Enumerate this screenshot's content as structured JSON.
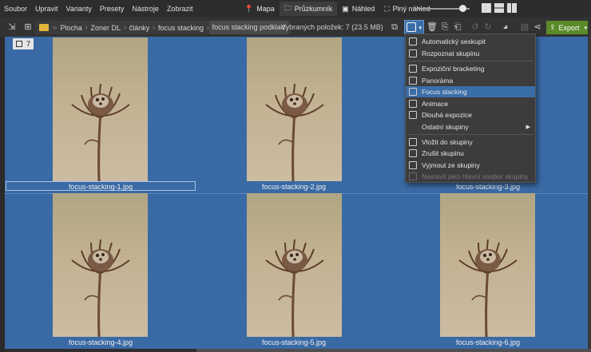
{
  "menubar": {
    "items": [
      "Soubor",
      "Upravit",
      "Varianty",
      "Presety",
      "Nástroje",
      "Zobrazit"
    ],
    "modes": [
      {
        "label": "Mapa",
        "icon": "pin-icon"
      },
      {
        "label": "Průzkumník",
        "icon": "folder-open-icon"
      },
      {
        "label": "Náhled",
        "icon": "image-icon"
      },
      {
        "label": "Plný náhled",
        "icon": "fullscreen-icon"
      }
    ],
    "active_mode": "Průzkumník"
  },
  "toolbar": {
    "breadcrumb": [
      "Plocha",
      "Zoner DL",
      "články",
      "focus stacking",
      "focus stacking podklad"
    ],
    "selection_info": "Vybraných položek: 7 (23.5 MB)",
    "export_label": "Export"
  },
  "content": {
    "count_badge": "7",
    "files": [
      "focus-stacking-1.jpg",
      "focus-stacking-2.jpg",
      "focus-stacking-3.jpg",
      "focus-stacking-4.jpg",
      "focus-stacking-5.jpg",
      "focus-stacking-6.jpg"
    ],
    "selected_file": "focus-stacking-1.jpg"
  },
  "dropdown": {
    "items": [
      {
        "label": "Automatický seskupit",
        "icon": "auto-group-icon",
        "enabled": true
      },
      {
        "label": "Rozpoznat skupinu",
        "icon": "detect-group-icon",
        "enabled": true
      },
      {
        "label": "Expoziční bracketing",
        "icon": "exposure-bracketing-icon",
        "enabled": true
      },
      {
        "label": "Panoráma",
        "icon": "panorama-icon",
        "enabled": true
      },
      {
        "label": "Focus stacking",
        "icon": "focus-stacking-icon",
        "enabled": true,
        "highlighted": true
      },
      {
        "label": "Animace",
        "icon": "animation-icon",
        "enabled": true
      },
      {
        "label": "Dlouhá expozice",
        "icon": "long-exposure-icon",
        "enabled": true
      },
      {
        "label": "Ostatní skupiny",
        "icon": "",
        "enabled": true,
        "submenu": true
      },
      {
        "label": "Vložit do skupiny",
        "icon": "insert-group-icon",
        "enabled": true
      },
      {
        "label": "Zrušit skupinu",
        "icon": "ungroup-icon",
        "enabled": true
      },
      {
        "label": "Vyjmout ze skupiny",
        "icon": "remove-from-group-icon",
        "enabled": true
      },
      {
        "label": "Nastavit jako hlavní soubor skupiny",
        "icon": "set-main-icon",
        "enabled": false
      }
    ]
  },
  "colors": {
    "background": "#2b2b2b",
    "content_bg": "#3a6aa5",
    "highlight": "#3a6ea8",
    "export": "#5a8a2a",
    "folder": "#e3b53c"
  }
}
